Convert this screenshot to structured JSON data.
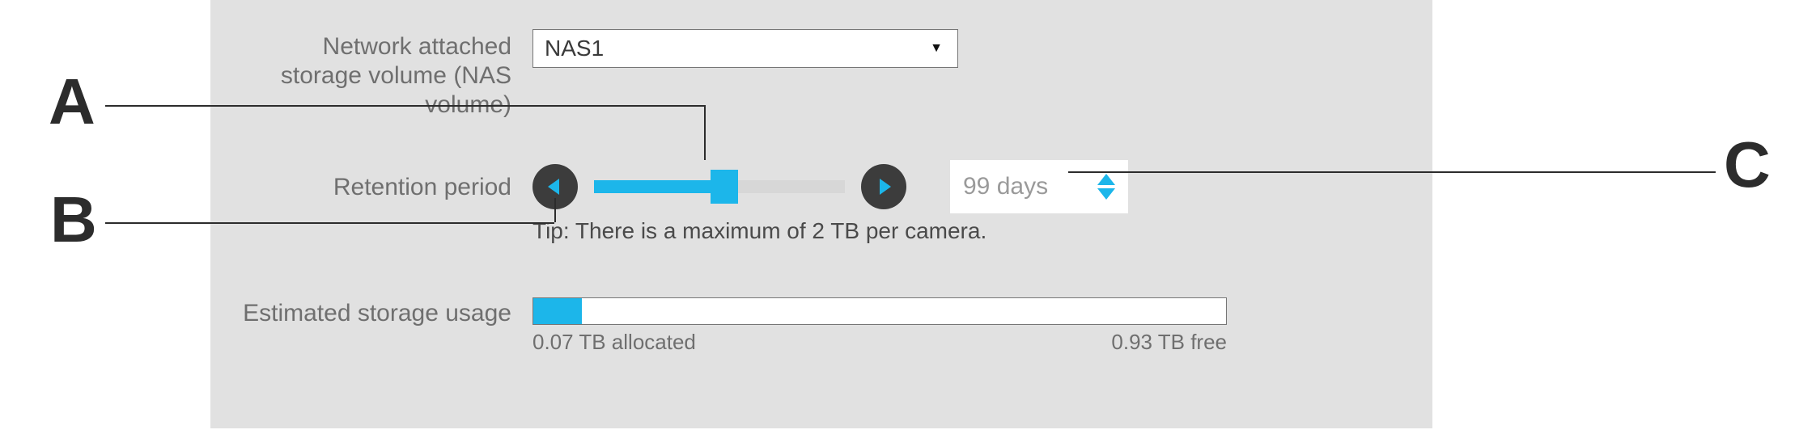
{
  "nas": {
    "label": "Network attached storage volume (NAS volume)",
    "selected": "NAS1"
  },
  "retention": {
    "label": "Retention period",
    "value_text": "99 days",
    "slider_percent": 52,
    "tip": "Tip: There is a maximum of 2 TB per camera."
  },
  "usage": {
    "label": "Estimated storage usage",
    "allocated_text": "0.07 TB allocated",
    "free_text": "0.93 TB free",
    "fill_percent": 7
  },
  "annotations": {
    "A": "A",
    "B": "B",
    "C": "C"
  },
  "colors": {
    "accent": "#1cb6ea",
    "panel_bg": "#e1e1e1",
    "btn_dark": "#3c3c3c",
    "text_muted": "#6f6f6f"
  }
}
